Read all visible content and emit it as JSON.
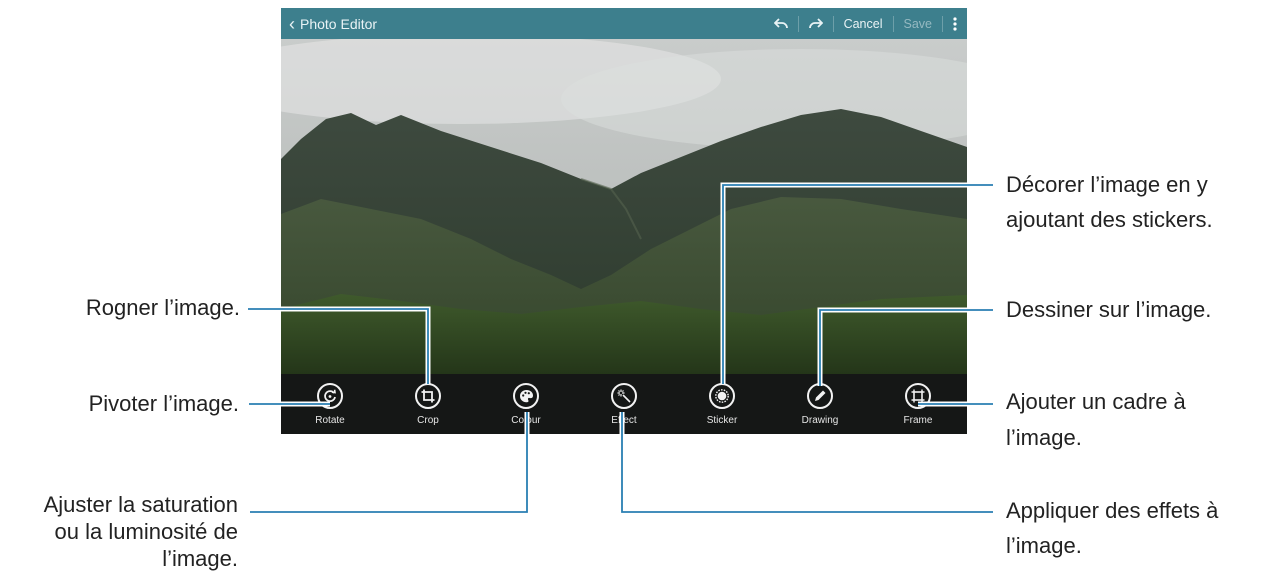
{
  "topbar": {
    "title": "Photo Editor",
    "undo_icon": "undo-icon",
    "redo_icon": "redo-icon",
    "cancel_label": "Cancel",
    "save_label": "Save",
    "menu_icon": "more-vert-icon"
  },
  "tools": [
    {
      "label": "Rotate",
      "icon": "rotate-icon"
    },
    {
      "label": "Crop",
      "icon": "crop-icon"
    },
    {
      "label": "Colour",
      "icon": "palette-icon"
    },
    {
      "label": "Effect",
      "icon": "magic-wand-icon"
    },
    {
      "label": "Sticker",
      "icon": "sticker-icon"
    },
    {
      "label": "Drawing",
      "icon": "pencil-icon"
    },
    {
      "label": "Frame",
      "icon": "frame-icon"
    }
  ],
  "captions": {
    "crop": "Rogner l’image.",
    "rotate": "Pivoter l’image.",
    "colour_1": "Ajuster la saturation",
    "colour_2": "ou la luminosité de",
    "colour_3": "l’image.",
    "sticker_1": "Décorer l’image en y",
    "sticker_2": "ajoutant des stickers.",
    "drawing": "Dessiner sur l’image.",
    "frame_1": "Ajouter un cadre à",
    "frame_2": "l’image.",
    "effect_1": "Appliquer des effets à",
    "effect_2": "l’image."
  },
  "colors": {
    "topbar": "#3d7f8d",
    "callout_line": "#2a7fb2",
    "toolbar": "#151716"
  }
}
